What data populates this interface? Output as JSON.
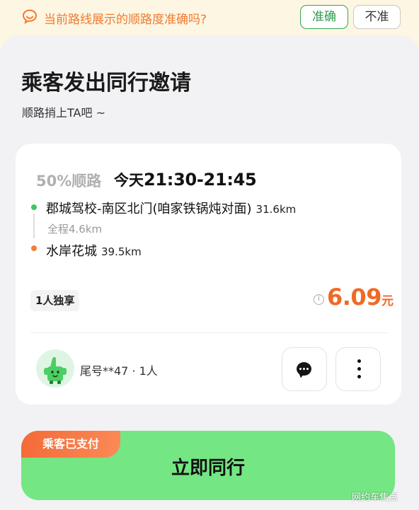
{
  "feedback": {
    "question": "当前路线展示的顺路度准确吗?",
    "yes_label": "准确",
    "no_label": "不准"
  },
  "header": {
    "title": "乘客发出同行邀请",
    "subtitle": "顺路捎上TA吧 ~"
  },
  "trip": {
    "match_percent": "50%顺路",
    "day": "今天",
    "time_range": "21:30-21:45",
    "start": {
      "place": "郡城驾校-南区北门(咱家铁锅炖对面)",
      "distance": "31.6km"
    },
    "total": "全程4.6km",
    "end": {
      "place": "水岸花城",
      "distance": "39.5km"
    },
    "tag": "1人独享",
    "price": "6.09",
    "price_unit": "元",
    "info_glyph": "i"
  },
  "passenger": {
    "tail_info": "尾号**47 · 1人"
  },
  "cta": {
    "badge": "乘客已支付",
    "label": "立即同行"
  },
  "watermark": "网约车焦点",
  "colors": {
    "accent_green": "#74e683",
    "price_orange": "#f06a25",
    "banner_orange": "#f07a2f",
    "confirm_green": "#31a651"
  },
  "icons": {
    "banner": "feedback-bubble-icon",
    "info": "info-icon",
    "chat": "chat-icon",
    "more": "more-vertical-icon"
  }
}
